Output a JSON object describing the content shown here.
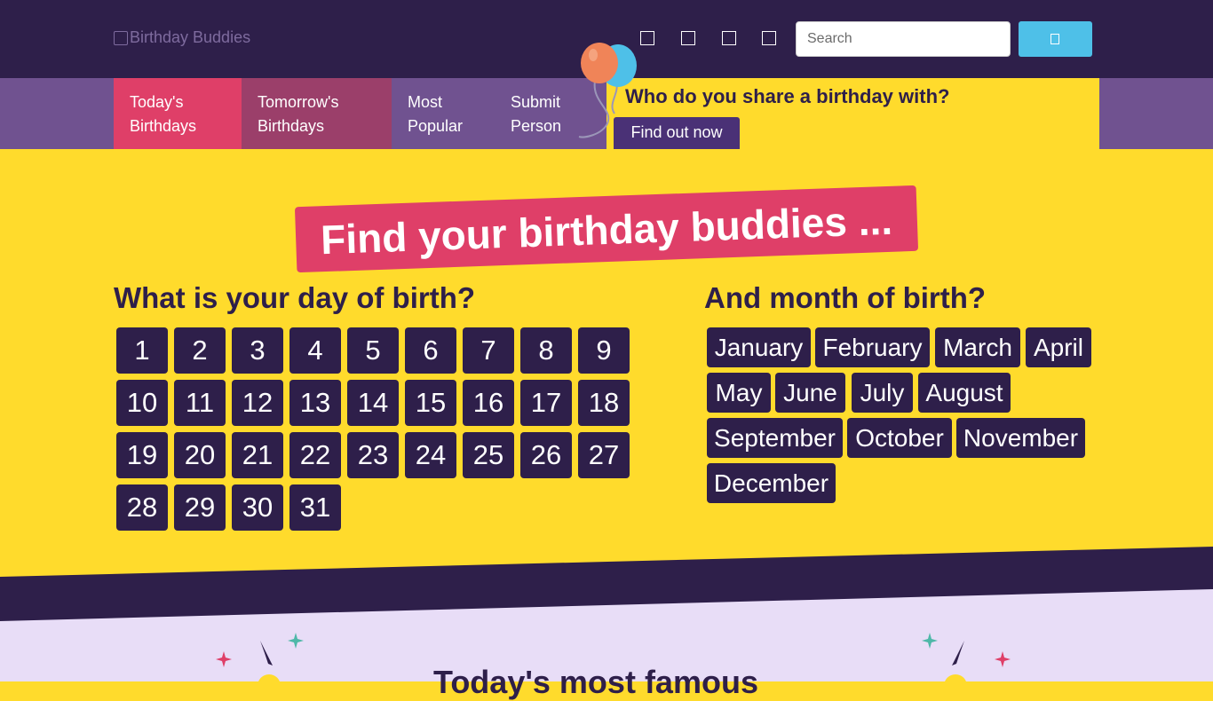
{
  "header": {
    "logo_alt": "Birthday Buddies",
    "social_icons": [
      "facebook-icon",
      "twitter-icon",
      "instagram-icon",
      "pinterest-icon"
    ],
    "search": {
      "placeholder": "Search",
      "button_icon": "search-icon"
    }
  },
  "nav": {
    "items": [
      {
        "line1": "Today's",
        "line2": "Birthdays"
      },
      {
        "line1": "Tomorrow's",
        "line2": "Birthdays"
      },
      {
        "line1": "Most",
        "line2": "Popular"
      },
      {
        "line1": "Submit",
        "line2": "Person"
      }
    ],
    "promo": {
      "question": "Who do you share a birthday with?",
      "button": "Find out now"
    }
  },
  "hero": {
    "title": "Find your birthday buddies ...",
    "day_heading": "What is your day of birth?",
    "month_heading": "And month of birth?",
    "days": [
      "1",
      "2",
      "3",
      "4",
      "5",
      "6",
      "7",
      "8",
      "9",
      "10",
      "11",
      "12",
      "13",
      "14",
      "15",
      "16",
      "17",
      "18",
      "19",
      "20",
      "21",
      "22",
      "23",
      "24",
      "25",
      "26",
      "27",
      "28",
      "29",
      "30",
      "31"
    ],
    "months": [
      "January",
      "February",
      "March",
      "April",
      "May",
      "June",
      "July",
      "August",
      "September",
      "October",
      "November",
      "December"
    ]
  },
  "next_section": {
    "heading": "Today's most famous"
  },
  "colors": {
    "header_bg": "#2e1f4a",
    "nav_bg": "#705290",
    "accent_yellow": "#ffdb2c",
    "accent_pink": "#df3f68",
    "button_blue": "#4ec0e8"
  }
}
